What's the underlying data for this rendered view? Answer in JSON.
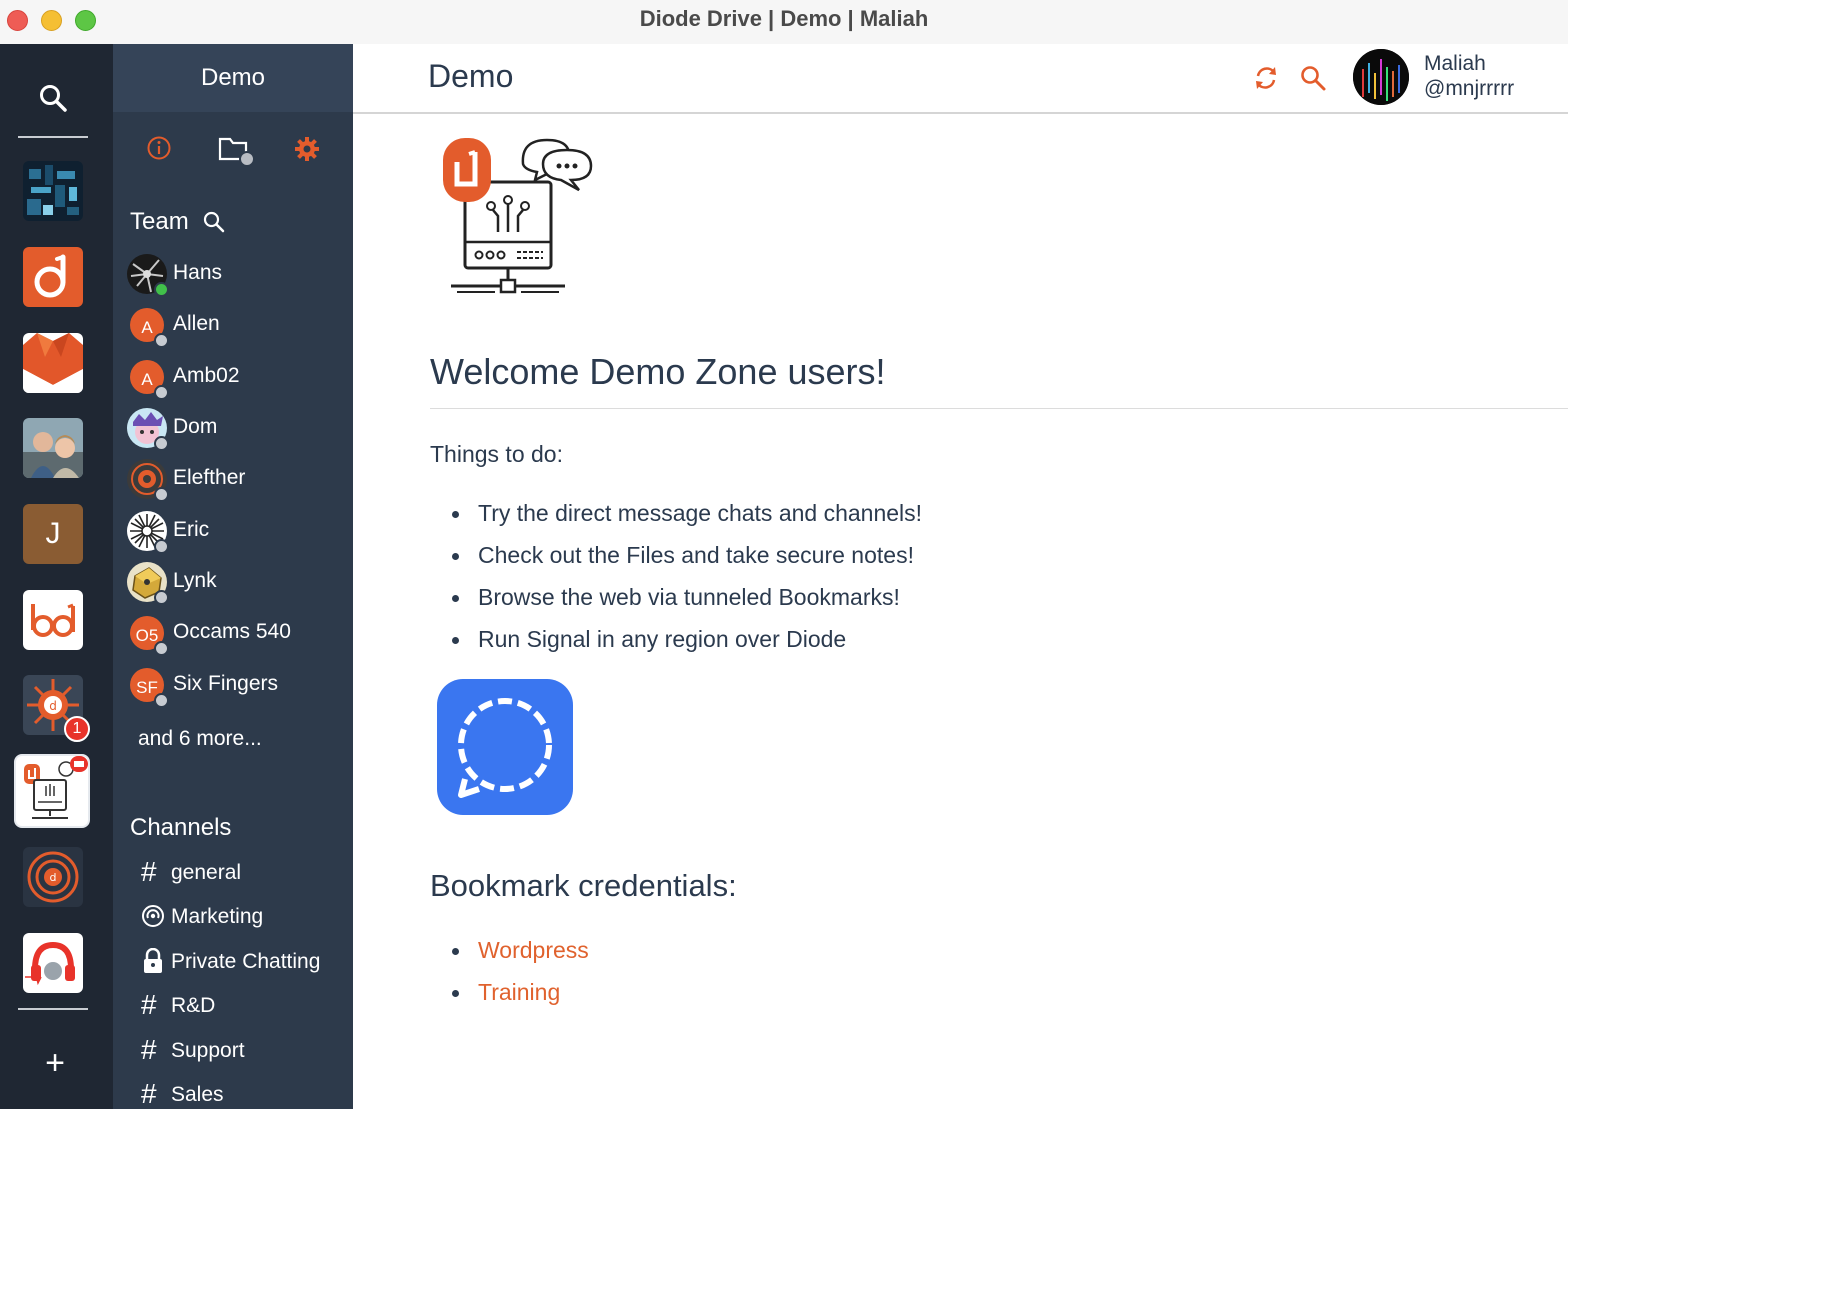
{
  "window": {
    "title": "Diode Drive | Demo | Maliah"
  },
  "colors": {
    "accent": "#e35c2c",
    "rail_bg": "#1f2733",
    "sidebar_bg": "#2d3a4b",
    "sidebar_header_bg": "#354458",
    "link": "#e0622e",
    "online": "#41c04a",
    "badge": "#e8332a"
  },
  "rail": {
    "zones": [
      {
        "icon": "zone-circuit-icon"
      },
      {
        "icon": "zone-diode-logo-icon"
      },
      {
        "icon": "zone-mail-icon"
      },
      {
        "icon": "zone-people-photo-icon"
      },
      {
        "letter": "J"
      },
      {
        "icon": "zone-bd-logo-icon"
      },
      {
        "icon": "zone-diode-gear-icon",
        "badge": "1"
      },
      {
        "icon": "zone-demo-icon",
        "active": true
      },
      {
        "icon": "zone-diode-orbit-icon"
      },
      {
        "icon": "zone-headphones-icon"
      }
    ],
    "add_label": "+"
  },
  "sidebar": {
    "zone_name": "Demo",
    "team_title": "Team",
    "members": [
      {
        "name": "Hans",
        "initials": "",
        "online": true
      },
      {
        "name": "Allen",
        "initials": "A",
        "online": false
      },
      {
        "name": "Amb02",
        "initials": "A",
        "online": false
      },
      {
        "name": "Dom",
        "initials": "",
        "online": false
      },
      {
        "name": "Elefther",
        "initials": "",
        "online": false
      },
      {
        "name": "Eric",
        "initials": "",
        "online": false
      },
      {
        "name": "Lynk",
        "initials": "",
        "online": false
      },
      {
        "name": "Occams 540",
        "initials": "O5",
        "online": false
      },
      {
        "name": "Six Fingers",
        "initials": "SF",
        "online": false
      }
    ],
    "more_label": "and 6 more...",
    "channels_title": "Channels",
    "channels": [
      {
        "name": "general",
        "icon": "hash"
      },
      {
        "name": "Marketing",
        "icon": "broadcast"
      },
      {
        "name": "Private Chatting",
        "icon": "lock"
      },
      {
        "name": "R&D",
        "icon": "hash"
      },
      {
        "name": "Support",
        "icon": "hash"
      },
      {
        "name": "Sales",
        "icon": "hash"
      }
    ]
  },
  "header": {
    "title": "Demo",
    "user": {
      "name": "Maliah",
      "handle": "@mnjrrrrr"
    }
  },
  "main": {
    "welcome": "Welcome Demo Zone users!",
    "things_title": "Things to do:",
    "todo": [
      "Try the direct message chats and channels!",
      "Check out the Files and take secure notes!",
      "Browse the web via tunneled Bookmarks!",
      "Run Signal in any region over Diode"
    ],
    "bookmarks_title": "Bookmark credentials:",
    "bookmarks": [
      "Wordpress",
      "Training"
    ]
  }
}
